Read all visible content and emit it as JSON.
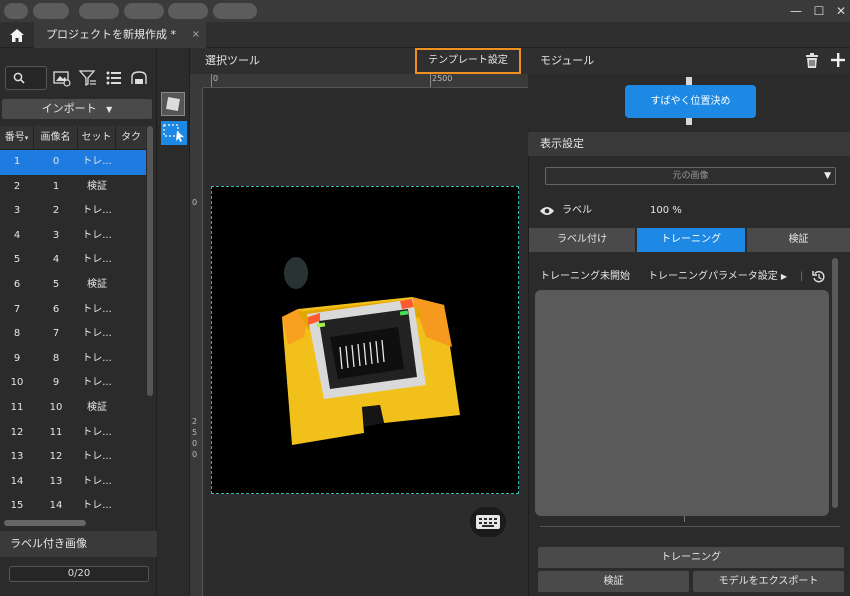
{
  "titlebar": {
    "window_controls": {
      "minimize": "—",
      "maximize": "☐",
      "close": "✕"
    }
  },
  "tab": {
    "home_icon": "home-icon",
    "project_label": "プロジェクトを新規作成 *",
    "close_glyph": "×"
  },
  "left_panel": {
    "import_label": "インポート",
    "columns": [
      "番号",
      "画像名",
      "セット",
      "タク"
    ],
    "rows": [
      {
        "no": "1",
        "name": "0",
        "set": "トレ..."
      },
      {
        "no": "2",
        "name": "1",
        "set": "検証"
      },
      {
        "no": "3",
        "name": "2",
        "set": "トレ..."
      },
      {
        "no": "4",
        "name": "3",
        "set": "トレ..."
      },
      {
        "no": "5",
        "name": "4",
        "set": "トレ..."
      },
      {
        "no": "6",
        "name": "5",
        "set": "検証"
      },
      {
        "no": "7",
        "name": "6",
        "set": "トレ..."
      },
      {
        "no": "8",
        "name": "7",
        "set": "トレ..."
      },
      {
        "no": "9",
        "name": "8",
        "set": "トレ..."
      },
      {
        "no": "10",
        "name": "9",
        "set": "トレ..."
      },
      {
        "no": "11",
        "name": "10",
        "set": "検証"
      },
      {
        "no": "12",
        "name": "11",
        "set": "トレ..."
      },
      {
        "no": "13",
        "name": "12",
        "set": "トレ..."
      },
      {
        "no": "14",
        "name": "13",
        "set": "トレ..."
      },
      {
        "no": "15",
        "name": "14",
        "set": "トレ..."
      }
    ],
    "selected_row": 0,
    "labeled_header": "ラベル付き画像",
    "progress_text": "0/20"
  },
  "canvas": {
    "title": "選択ツール",
    "template_button": "テンプレート設定",
    "ruler_top_labels": [
      "0",
      "2500"
    ],
    "ruler_left_labels": [
      "0",
      "2500"
    ]
  },
  "right_panel": {
    "module_title": "モジュール",
    "quick_locate_button": "すばやく位置決め",
    "display_header": "表示設定",
    "image_select_value": "元の画像",
    "label_text": "ラベル",
    "opacity_value": "100 %",
    "tabs": [
      {
        "label": "ラベル付け",
        "active": false
      },
      {
        "label": "トレーニング",
        "active": true
      },
      {
        "label": "検証",
        "active": false
      }
    ],
    "training_status": "トレーニング未開始",
    "training_params": "トレーニングパラメータ設定",
    "train_button": "トレーニング",
    "validate_button": "検証",
    "export_button": "モデルをエクスポート"
  },
  "colors": {
    "accent": "#1e88e5",
    "highlight_border": "#f0901e",
    "roi_border": "#2fb9b0"
  }
}
